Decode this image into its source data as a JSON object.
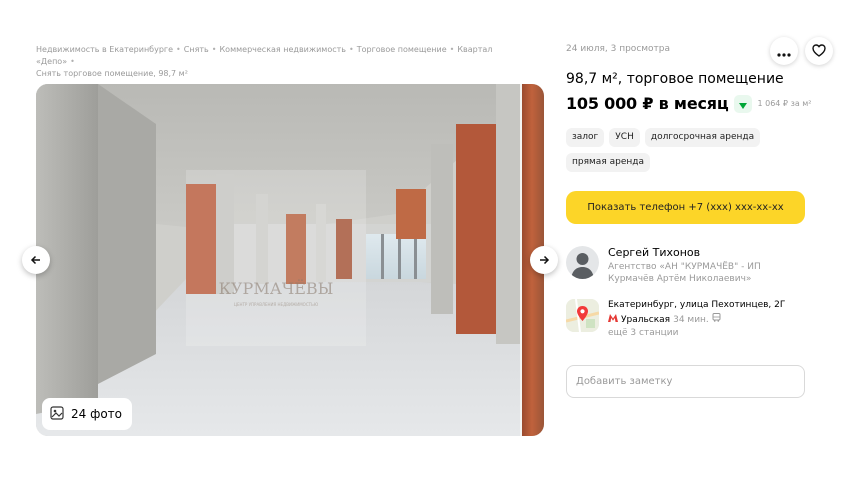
{
  "breadcrumbs": {
    "items": [
      "Недвижимость в Екатеринбурге",
      "Снять",
      "Коммерческая недвижимость",
      "Торговое помещение",
      "Квартал «Депо»",
      "Снять торговое помещение, 98,7 м²"
    ],
    "separator": "•"
  },
  "gallery": {
    "photo_count_label": "24 фото",
    "watermark_text": "КУРМАЧЁВЫ",
    "watermark_sub": "ЦЕНТР УПРАВЛЕНИЯ НЕДВИЖИМОСТЬЮ",
    "prev_icon": "arrow-left-icon",
    "next_icon": "arrow-right-icon",
    "photo_icon": "image-icon"
  },
  "listing": {
    "meta": "24 июля, 3 просмотра",
    "title": "98,7 м², торговое помещение",
    "price": "105 000 ₽ в месяц",
    "price_per_m2": "1 064 ₽ за м²",
    "price_trend": "down",
    "tags": [
      "залог",
      "УСН",
      "долгосрочная аренда",
      "прямая аренда"
    ],
    "phone_button": "Показать телефон +7 (xxx) xxx-xx-xx"
  },
  "seller": {
    "name": "Сергей Тихонов",
    "agency": "Агентство «АН \"КУРМАЧЁВ\" - ИП Курмачёв Артём Николаевич»"
  },
  "location": {
    "address": "Екатеринбург, улица Пехотинцев, 2Г",
    "metro_station": "Уральская",
    "metro_time": "34 мин.",
    "more_stations": "ещё 3 станции",
    "metro_color": "#e53935"
  },
  "note": {
    "placeholder": "Добавить заметку"
  },
  "colors": {
    "accent_yellow": "#fcd528",
    "price_drop_green": "#00a637",
    "muted_text": "#9a9a9a"
  }
}
